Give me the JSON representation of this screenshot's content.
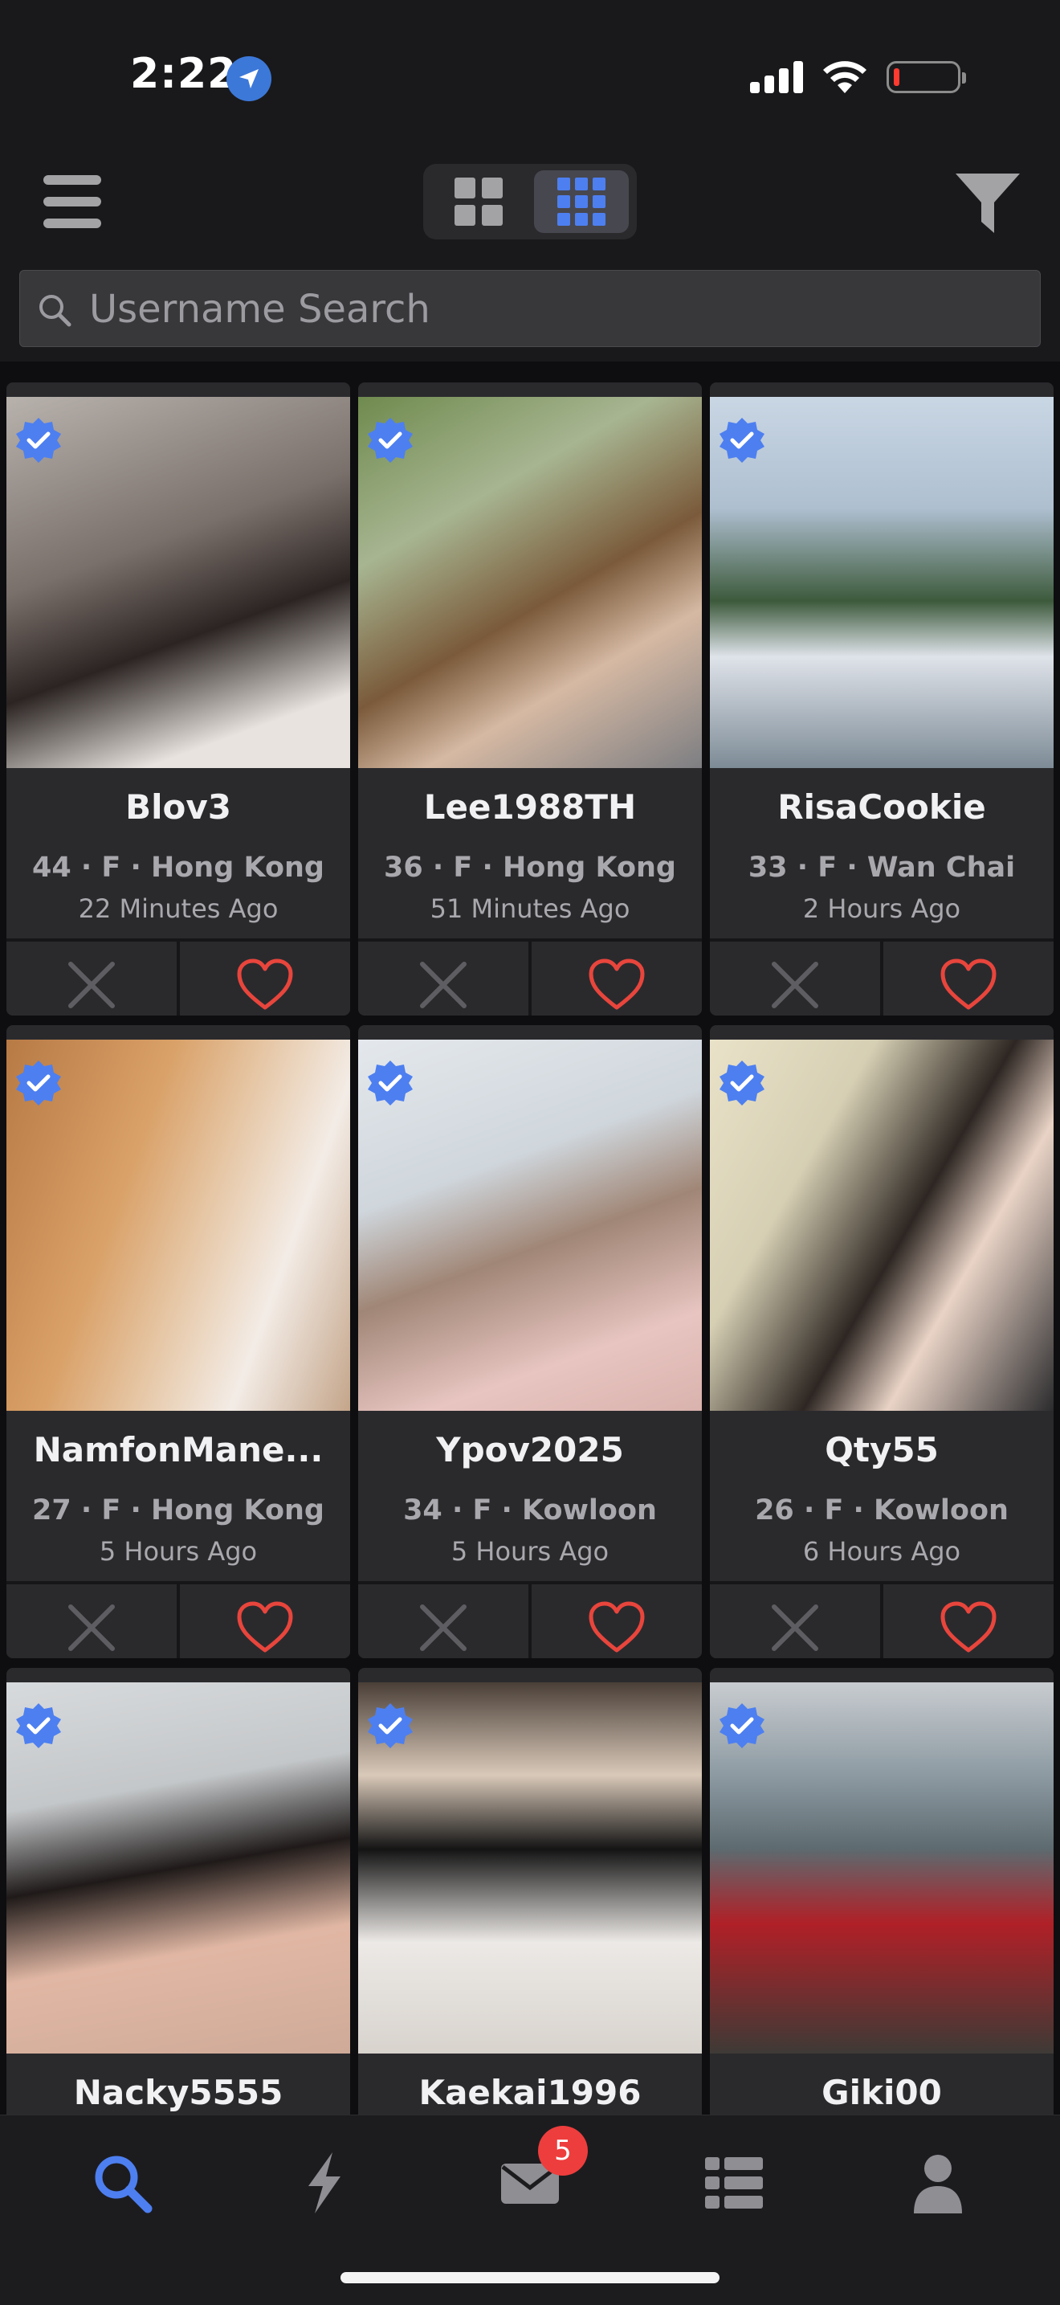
{
  "status": {
    "time": "2:22"
  },
  "search": {
    "placeholder": "Username Search"
  },
  "profiles": [
    {
      "username": "Blov3",
      "meta": "44 · F · Hong Kong",
      "last_active": "22 Minutes Ago",
      "verified": true
    },
    {
      "username": "Lee1988TH",
      "meta": "36 · F · Hong Kong",
      "last_active": "51 Minutes Ago",
      "verified": true
    },
    {
      "username": "RisaCookie",
      "meta": "33 · F · Wan Chai",
      "last_active": "2 Hours Ago",
      "verified": true
    },
    {
      "username": "NamfonMane...",
      "meta": "27 · F · Hong Kong",
      "last_active": "5 Hours Ago",
      "verified": true
    },
    {
      "username": "Ypov2025",
      "meta": "34 · F · Kowloon",
      "last_active": "5 Hours Ago",
      "verified": true
    },
    {
      "username": "Qty55",
      "meta": "26 · F · Kowloon",
      "last_active": "6 Hours Ago",
      "verified": true
    },
    {
      "username": "Nacky5555",
      "meta": "",
      "last_active": "",
      "verified": true
    },
    {
      "username": "Kaekai1996",
      "meta": "",
      "last_active": "",
      "verified": true
    },
    {
      "username": "Giki00",
      "meta": "",
      "last_active": "",
      "verified": true
    }
  ],
  "tabs": [
    {
      "icon": "search-icon",
      "active": true
    },
    {
      "icon": "lightning-icon",
      "active": false
    },
    {
      "icon": "mail-icon",
      "active": false
    },
    {
      "icon": "list-icon",
      "active": false
    },
    {
      "icon": "person-icon",
      "active": false
    }
  ],
  "messages_badge": "5",
  "colors": {
    "accent": "#4d7ff0",
    "like": "#e8453c",
    "badge": "#ee3d3d",
    "background": "#19191b",
    "card": "#2a2a2d"
  }
}
